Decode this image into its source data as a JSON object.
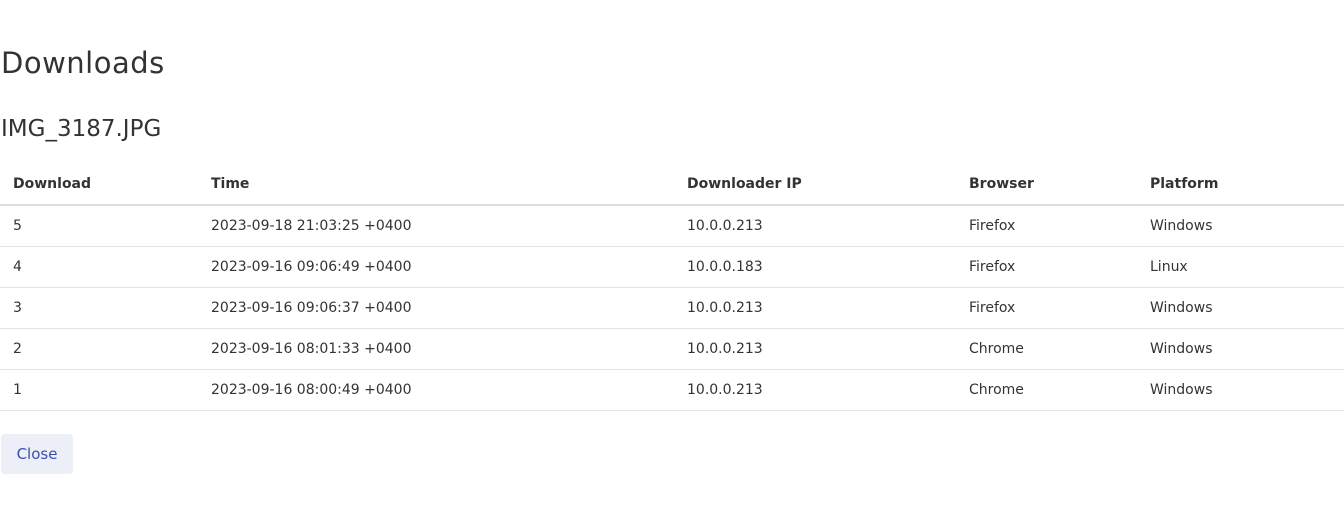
{
  "page_title": "Downloads",
  "file_name": "IMG_3187.JPG",
  "table": {
    "headers": [
      "Download",
      "Time",
      "Downloader IP",
      "Browser",
      "Platform"
    ],
    "rows": [
      [
        "5",
        "2023-09-18 21:03:25 +0400",
        "10.0.0.213",
        "Firefox",
        "Windows"
      ],
      [
        "4",
        "2023-09-16 09:06:49 +0400",
        "10.0.0.183",
        "Firefox",
        "Linux"
      ],
      [
        "3",
        "2023-09-16 09:06:37 +0400",
        "10.0.0.213",
        "Firefox",
        "Windows"
      ],
      [
        "2",
        "2023-09-16 08:01:33 +0400",
        "10.0.0.213",
        "Chrome",
        "Windows"
      ],
      [
        "1",
        "2023-09-16 08:00:49 +0400",
        "10.0.0.213",
        "Chrome",
        "Windows"
      ]
    ]
  },
  "close_label": "Close"
}
